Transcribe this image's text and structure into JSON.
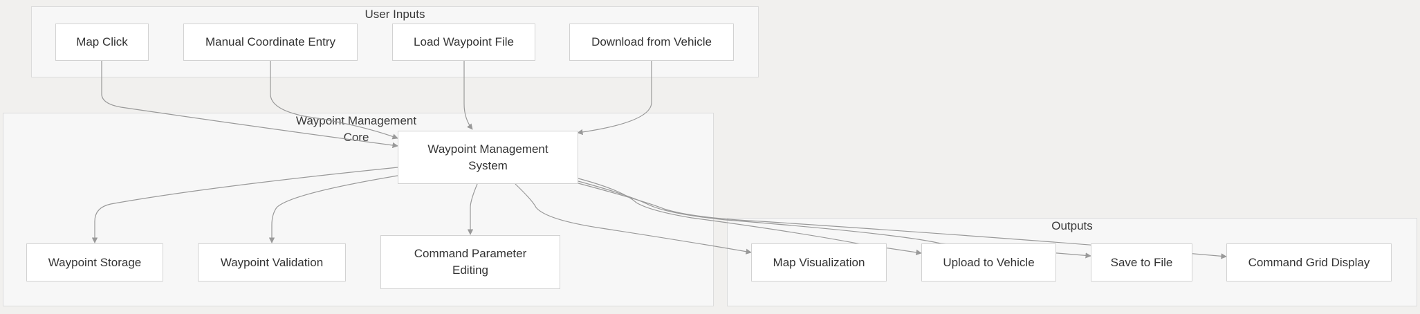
{
  "clusters": {
    "user_inputs": "User Inputs",
    "core_line1": "Waypoint Management",
    "core_line2": "Core",
    "outputs": "Outputs"
  },
  "nodes": {
    "map_click": "Map Click",
    "manual_entry": "Manual Coordinate Entry",
    "load_file": "Load Waypoint File",
    "download_vehicle": "Download from Vehicle",
    "wms_line1": "Waypoint Management",
    "wms_line2": "System",
    "storage": "Waypoint Storage",
    "validation": "Waypoint Validation",
    "cmd_edit_line1": "Command Parameter",
    "cmd_edit_line2": "Editing",
    "map_vis": "Map Visualization",
    "upload_vehicle": "Upload to Vehicle",
    "save_file": "Save to File",
    "cmd_grid": "Command Grid Display"
  },
  "colors": {
    "background": "#f1f0ee",
    "cluster_fill": "#f7f7f7",
    "node_fill": "#ffffff",
    "edge": "#999999"
  }
}
